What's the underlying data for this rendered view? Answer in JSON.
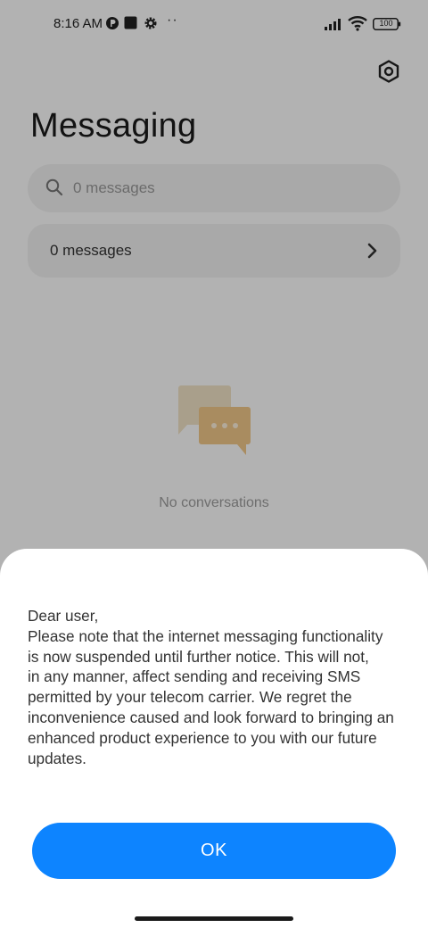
{
  "status_bar": {
    "time": "8:16 AM",
    "battery": "100",
    "icons": [
      "circle-app-icon",
      "square-app-icon",
      "gear-small-icon",
      "more-dots-icon",
      "signal-icon",
      "wifi-icon",
      "battery-icon"
    ],
    "more": "··"
  },
  "header": {
    "title": "Messaging",
    "settings_icon": "hexagon-settings-icon"
  },
  "search": {
    "placeholder": "0 messages",
    "icon": "search-icon"
  },
  "messages_card": {
    "label": "0 messages",
    "icon": "chevron-right-icon"
  },
  "empty_state": {
    "text": "No conversations",
    "icon": "chat-bubbles-icon",
    "accent_color": "#f3c98a"
  },
  "dialog": {
    "lines": [
      "Dear user,",
      "Please note that the internet messaging functionality",
      "is now suspended until further notice. This will not,",
      "in any manner, affect sending and receiving SMS",
      "permitted by your telecom carrier. We regret the",
      "inconvenience caused and look forward to bringing an",
      "enhanced product experience to you with our future",
      "updates."
    ],
    "ok_label": "OK",
    "ok_color": "#0d84ff"
  }
}
